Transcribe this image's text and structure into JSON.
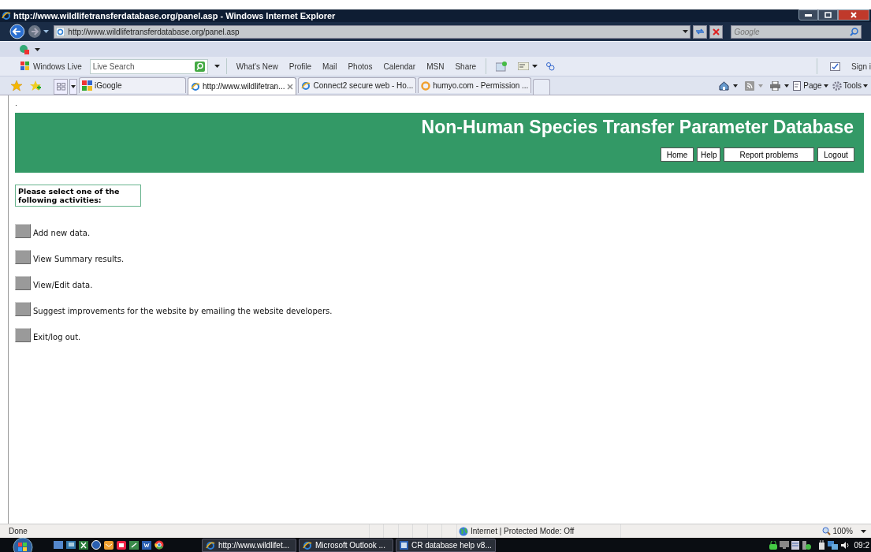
{
  "window": {
    "title": "http://www.wildlifetransferdatabase.org/panel.asp - Windows Internet Explorer"
  },
  "address_bar": {
    "url": "http://www.wildlifetransferdatabase.org/panel.asp",
    "search_placeholder": "Google"
  },
  "live_toolbar": {
    "brand": "Windows Live",
    "search_placeholder": "Live Search",
    "links": [
      "What's New",
      "Profile",
      "Mail",
      "Photos",
      "Calendar",
      "MSN",
      "Share"
    ],
    "sign_in": "Sign i"
  },
  "tabs": [
    {
      "label": "iGoogle",
      "selected": false
    },
    {
      "label": "http://www.wildlifetran...",
      "selected": true
    },
    {
      "label": "Connect2 secure web - Ho...",
      "selected": false
    },
    {
      "label": "humyo.com - Permission ...",
      "selected": false
    }
  ],
  "command_bar": {
    "page": "Page",
    "tools": "Tools"
  },
  "page": {
    "dot": ".",
    "banner_title": "Non-Human Species Transfer Parameter Database",
    "nav_buttons": [
      "Home",
      "Help",
      "Report problems",
      "Logout"
    ],
    "prompt": "Please select one of the following activities:",
    "activities": [
      "Add new data.",
      "View Summary results.",
      "View/Edit data.",
      "Suggest improvements for the website by emailing the website developers.",
      "Exit/log out."
    ]
  },
  "status_bar": {
    "text": "Done",
    "zone": "Internet | Protected Mode: Off",
    "zoom": "100%"
  },
  "taskbar": {
    "tasks": [
      "http://www.wildlifet...",
      "Microsoft Outlook ...",
      "CR database help v8..."
    ],
    "clock": "09:2"
  }
}
